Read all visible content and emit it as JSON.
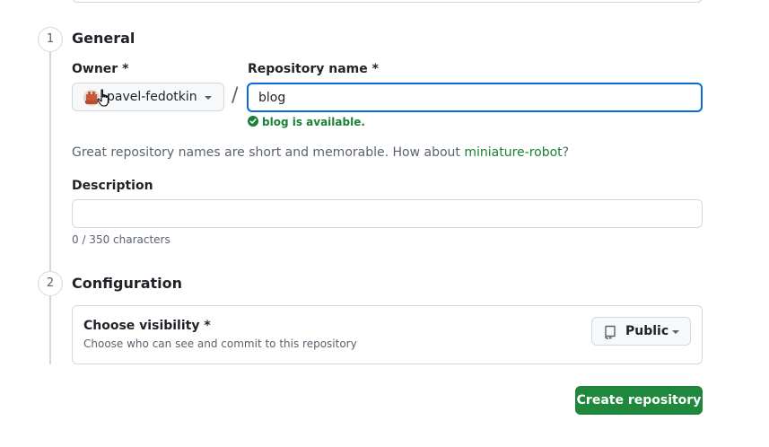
{
  "steps": [
    {
      "number": "1",
      "title": "General"
    },
    {
      "number": "2",
      "title": "Configuration"
    }
  ],
  "owner": {
    "label": "Owner *",
    "name": "pavel-fedotkin"
  },
  "repo_name": {
    "label": "Repository name *",
    "value": "blog",
    "availability": "blog is available."
  },
  "separator": "/",
  "suggestion": {
    "prefix": "Great repository names are short and memorable. How about ",
    "link": "miniature-robot",
    "suffix": "?"
  },
  "description": {
    "label": "Description",
    "value": "",
    "counter": "0 / 350 characters"
  },
  "visibility": {
    "title": "Choose visibility *",
    "subtitle": "Choose who can see and commit to this repository",
    "selected": "Public"
  },
  "actions": {
    "create_label": "Create repository"
  },
  "colors": {
    "success": "#1a7f37",
    "primary_button": "#1f883d",
    "focus": "#0969da"
  },
  "icons": [
    "avatar-icon",
    "chevron-down-icon",
    "check-circle-icon",
    "repo-icon",
    "pointer-cursor-icon"
  ]
}
